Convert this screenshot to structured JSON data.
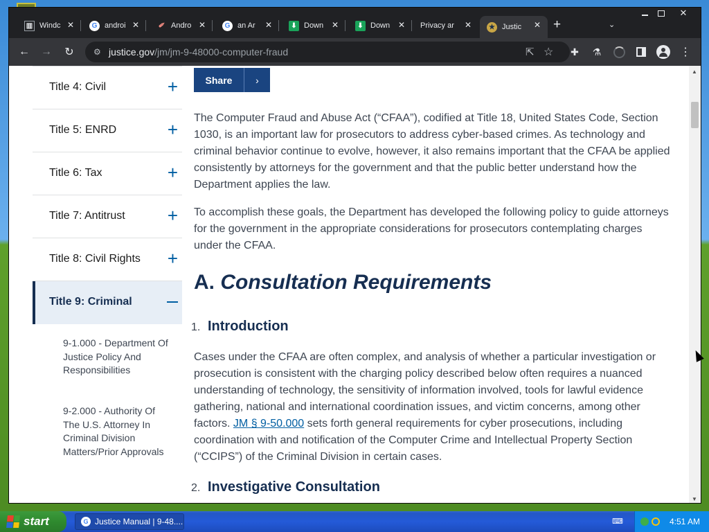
{
  "browser": {
    "tabs": [
      {
        "title": "Windc",
        "favicon": "window-icon",
        "active": false
      },
      {
        "title": "androi",
        "favicon": "google-icon",
        "active": false
      },
      {
        "title": "Andro",
        "favicon": "android-icon",
        "active": false
      },
      {
        "title": "an Ar",
        "favicon": "google-icon",
        "active": false
      },
      {
        "title": "Down",
        "favicon": "download-icon",
        "active": false
      },
      {
        "title": "Down",
        "favicon": "download-icon",
        "active": false
      },
      {
        "title": "Privacy ar",
        "favicon": "",
        "active": false
      },
      {
        "title": "Justic",
        "favicon": "doj-seal-icon",
        "active": true
      }
    ],
    "url": {
      "domain": "justice.gov",
      "path": "/jm/jm-9-48000-computer-fraud"
    }
  },
  "sidebar": {
    "items": [
      {
        "label": "Title 4: Civil",
        "expanded": false
      },
      {
        "label": "Title 5: ENRD",
        "expanded": false
      },
      {
        "label": "Title 6: Tax",
        "expanded": false
      },
      {
        "label": "Title 7: Antitrust",
        "expanded": false
      },
      {
        "label": "Title 8: Civil Rights",
        "expanded": false
      },
      {
        "label": "Title 9: Criminal",
        "expanded": true
      }
    ],
    "sub_items": [
      "9-1.000 - Department Of Justice Policy And Responsibilities",
      "9-2.000 - Authority Of The U.S. Attorney In Criminal Division Matters/Prior Approvals"
    ]
  },
  "content": {
    "share_label": "Share",
    "intro_p1": "The Computer Fraud and Abuse Act (“CFAA”), codified at Title 18, United States Code, Section 1030, is an important law for prosecutors to address cyber-based crimes. As technology and criminal behavior continue to evolve, however, it also remains important that the CFAA be applied consistently by attorneys for the government and that the public better understand how the Department applies the law.",
    "intro_p2": "To accomplish these goals, the Department has developed the following policy to guide attorneys for the government in the appropriate considerations for prosecutors contemplating charges under the CFAA.",
    "section_a_prefix": "A.",
    "section_a_title": "Consultation Requirements",
    "sub1_num": "1.",
    "sub1_title": "Introduction",
    "sub1_text_before": "Cases under the CFAA are often complex, and analysis of whether a particular investigation or prosecution is consistent with the charging policy described below often requires a nuanced understanding of technology, the sensitivity of information involved, tools for lawful evidence gathering, national and international coordination issues, and victim concerns, among other factors.",
    "sub1_link": "JM § 9-50.000",
    "sub1_text_after": "sets forth general requirements for cyber prosecutions, including coordination with and notification of the Computer Crime and Intellectual Property Section (“CCIPS”) of the Criminal Division in certain cases.",
    "sub2_num": "2.",
    "sub2_title": "Investigative Consultation"
  },
  "taskbar": {
    "start_label": "start",
    "task_title": "Justice Manual | 9-48....",
    "clock": "4:51 AM"
  }
}
